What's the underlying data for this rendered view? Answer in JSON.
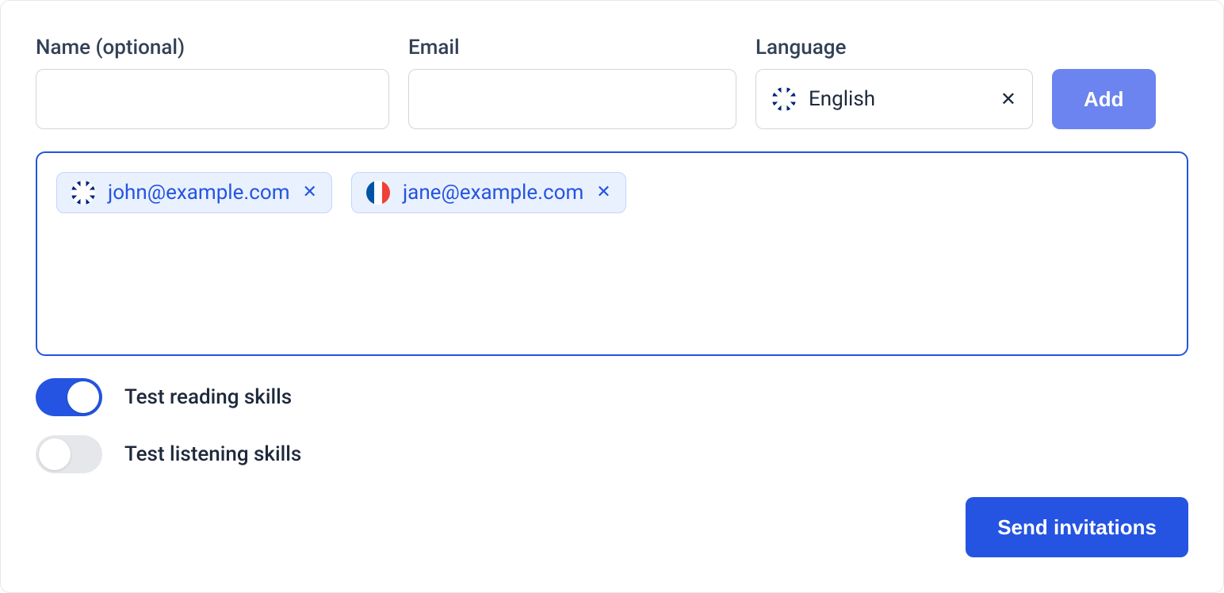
{
  "form": {
    "name_label": "Name (optional)",
    "email_label": "Email",
    "language_label": "Language",
    "language_selected": "English",
    "add_button": "Add"
  },
  "chips": [
    {
      "email": "john@example.com",
      "flag": "uk"
    },
    {
      "email": "jane@example.com",
      "flag": "fr"
    }
  ],
  "toggles": {
    "reading": {
      "label": "Test reading skills",
      "on": true
    },
    "listening": {
      "label": "Test listening skills",
      "on": false
    }
  },
  "send_button": "Send invitations"
}
